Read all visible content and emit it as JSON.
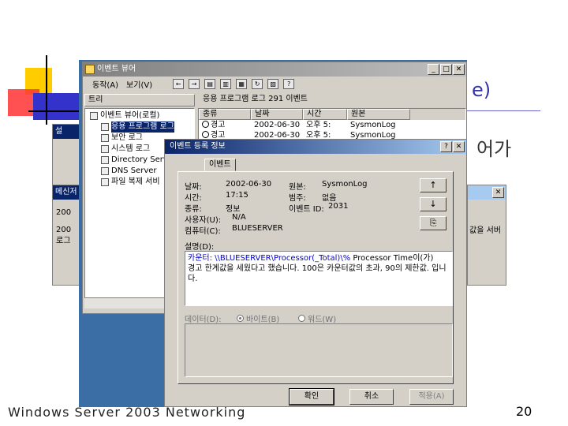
{
  "slide": {
    "title_tail": "e)",
    "bullet_tail": "어가",
    "footer": "Windows  Server 2003 Networking",
    "page_number": "20"
  },
  "event_viewer": {
    "title": "이벤트 뷰어",
    "menu": [
      "동작(A)",
      "보기(V)"
    ],
    "tree_header": "트리",
    "list_title": "응용 프로그램 로그   291 이벤트",
    "tree": [
      {
        "label": "이벤트 뷰어(로컬)",
        "level": 0
      },
      {
        "label": "응용 프로그램 로그",
        "level": 1,
        "selected": true
      },
      {
        "label": "보안 로그",
        "level": 1
      },
      {
        "label": "시스템 로그",
        "level": 1
      },
      {
        "label": "Directory Servic",
        "level": 1
      },
      {
        "label": "DNS Server",
        "level": 1
      },
      {
        "label": "파일 복제 서비",
        "level": 1
      }
    ],
    "columns": [
      "종류",
      "날짜",
      "시간",
      "원본"
    ],
    "rows": [
      {
        "type": "경고",
        "date": "2002-06-30",
        "time": "오후 5:",
        "source": "SysmonLog"
      },
      {
        "type": "경고",
        "date": "2002-06-30",
        "time": "오후 5:",
        "source": "SysmonLog"
      }
    ]
  },
  "side_windows": {
    "left_top_label": "설",
    "msg_title": "메신저",
    "msg_lines": [
      "200",
      "200",
      "로그"
    ],
    "right_text": "값을 서버"
  },
  "event_props": {
    "title": "이벤트 등록 정보",
    "tab": "이벤트",
    "fields": {
      "date_label": "날짜:",
      "date_value": "2002-06-30",
      "time_label": "시간:",
      "time_value": "17:15",
      "type_label": "종류:",
      "type_value": "정보",
      "user_label": "사용자(U):",
      "user_value": "N/A",
      "computer_label": "컴퓨터(C):",
      "computer_value": "BLUESERVER",
      "source_label": "원본:",
      "source_value": "SysmonLog",
      "category_label": "범주:",
      "category_value": "없음",
      "eventid_label": "이벤트 ID:",
      "eventid_value": "2031"
    },
    "desc_label": "설명(D):",
    "desc_line1_highlight": "카운터: \\\\BLUESERVER\\Processor(_Total)\\%",
    "desc_line1_rest": " Processor Time이(가)",
    "desc_line2": "경고 한계값을 세웠다고 했습니다. 100은 카운터값의 초과, 90의 제한값. 입니",
    "desc_line3": "다.",
    "data_label": "데이터(D):",
    "radio_bytes": "바이트(B)",
    "radio_words": "워드(W)",
    "nav_up": "↑",
    "nav_down": "↓",
    "nav_copy": "⎘",
    "buttons": {
      "ok": "확인",
      "cancel": "취소",
      "apply": "적용(A)"
    }
  }
}
